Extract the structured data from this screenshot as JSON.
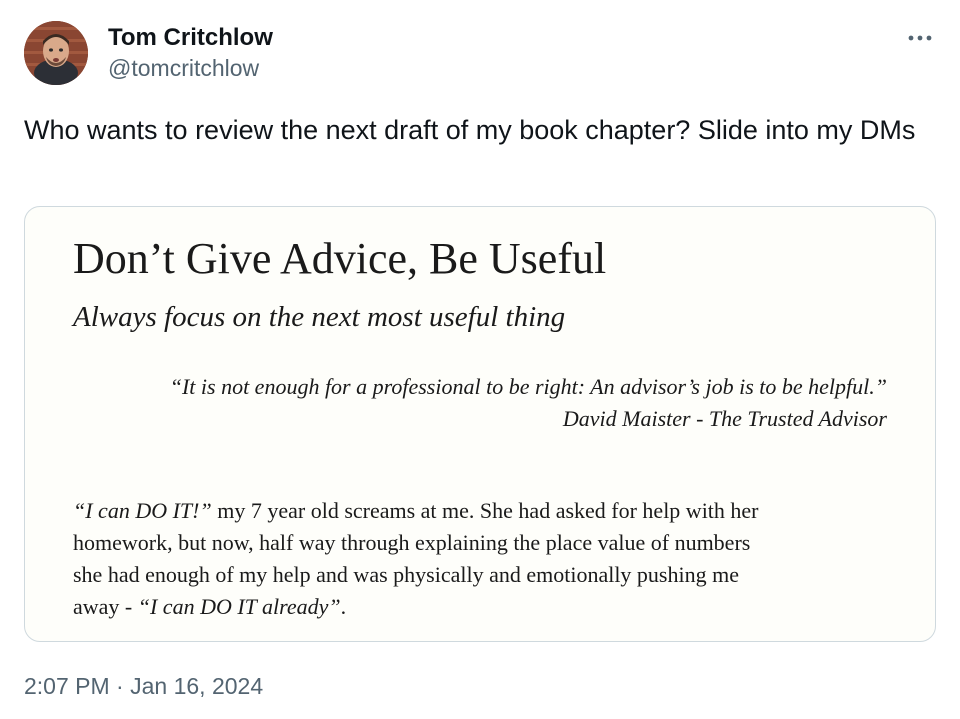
{
  "author": {
    "display_name": "Tom Critchlow",
    "handle": "@tomcritchlow",
    "avatar_icon": "avatar-photo"
  },
  "menu": {
    "icon": "more-horizontal-icon"
  },
  "tweet": {
    "text": "Who wants to review the next draft of my book chapter? Slide into my DMs"
  },
  "media": {
    "title": "Don’t Give Advice, Be Useful",
    "subtitle": "Always focus on the next most useful thing",
    "quote": "“It is not enough for a professional to be right: An advisor’s job is to be helpful.”",
    "quote_attribution": "David Maister - The Trusted Advisor",
    "body": {
      "l1_quote": "“I can DO IT!”",
      "l1_rest": " my 7 year old screams at me. She had asked for help with her",
      "l2": "homework, but now, half way through explaining the place value of numbers",
      "l3": "she had enough of my help and was physically and emotionally pushing me",
      "l4_start": "away - ",
      "l4_quote": "“I can DO IT already”",
      "l4_end": "."
    },
    "background_color": "#fefefa"
  },
  "meta": {
    "time": "2:07 PM",
    "separator": " · ",
    "date": "Jan 16, 2024"
  },
  "colors": {
    "text_primary": "#0f1419",
    "text_secondary": "#536471",
    "border": "#cfd9de"
  }
}
